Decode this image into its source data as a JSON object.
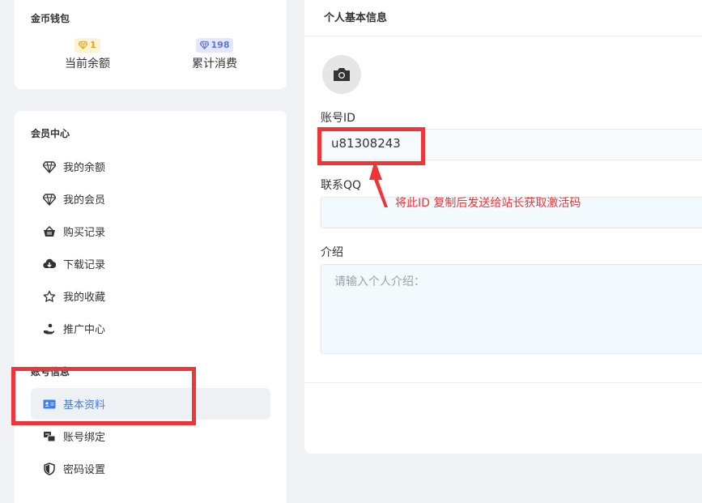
{
  "wallet": {
    "title": "金币钱包",
    "balance": {
      "value": "1",
      "label": "当前余额"
    },
    "spent": {
      "value": "198",
      "label": "累计消费"
    }
  },
  "member": {
    "title": "会员中心",
    "items": [
      {
        "label": "我的余额",
        "icon": "diamond-icon"
      },
      {
        "label": "我的会员",
        "icon": "diamond-icon"
      },
      {
        "label": "购买记录",
        "icon": "basket-icon"
      },
      {
        "label": "下载记录",
        "icon": "cloud-download-icon"
      },
      {
        "label": "我的收藏",
        "icon": "star-icon"
      },
      {
        "label": "推广中心",
        "icon": "hand-coin-icon"
      }
    ]
  },
  "account": {
    "title": "账号信息",
    "items": [
      {
        "label": "基本资料",
        "icon": "id-card-icon",
        "active": true
      },
      {
        "label": "账号绑定",
        "icon": "bind-icon"
      },
      {
        "label": "密码设置",
        "icon": "shield-icon"
      }
    ]
  },
  "profile": {
    "title": "个人基本信息",
    "account_id_label": "账号ID",
    "account_id_value": "u81308243",
    "qq_label": "联系QQ",
    "qq_value": "",
    "intro_label": "介绍",
    "intro_placeholder": "请输入个人介绍："
  },
  "annotation": {
    "text": "将此ID 复制后发送给站长获取激活码",
    "color": "#ee3537"
  },
  "colors": {
    "accent": "#3d7df0",
    "gold": "#e9a800",
    "blue_badge": "#5c74e6"
  }
}
